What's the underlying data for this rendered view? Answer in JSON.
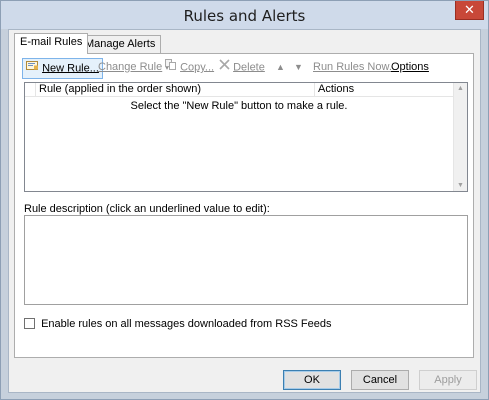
{
  "window": {
    "title": "Rules and Alerts",
    "close_glyph": "✕"
  },
  "tabs": [
    {
      "label": "E-mail Rules",
      "active": true
    },
    {
      "label": "Manage Alerts",
      "active": false
    }
  ],
  "toolbar": {
    "new_rule": "New Rule...",
    "change_rule": "Change Rule",
    "copy": "Copy...",
    "delete": "Delete",
    "move_up": "▲",
    "move_down": "▼",
    "run_rules_now": "Run Rules Now...",
    "options": "Options"
  },
  "rules_list": {
    "columns": [
      "Rule (applied in the order shown)",
      "Actions"
    ],
    "empty_message": "Select the \"New Rule\" button to make a rule."
  },
  "description": {
    "label": "Rule description (click an underlined value to edit):",
    "text": ""
  },
  "rss": {
    "label": "Enable rules on all messages downloaded from RSS Feeds",
    "checked": false
  },
  "buttons": {
    "ok": "OK",
    "cancel": "Cancel",
    "apply": "Apply"
  },
  "colors": {
    "titlebar": "#cfdaea",
    "close": "#c84838",
    "hover_border": "#7eb4ea"
  }
}
